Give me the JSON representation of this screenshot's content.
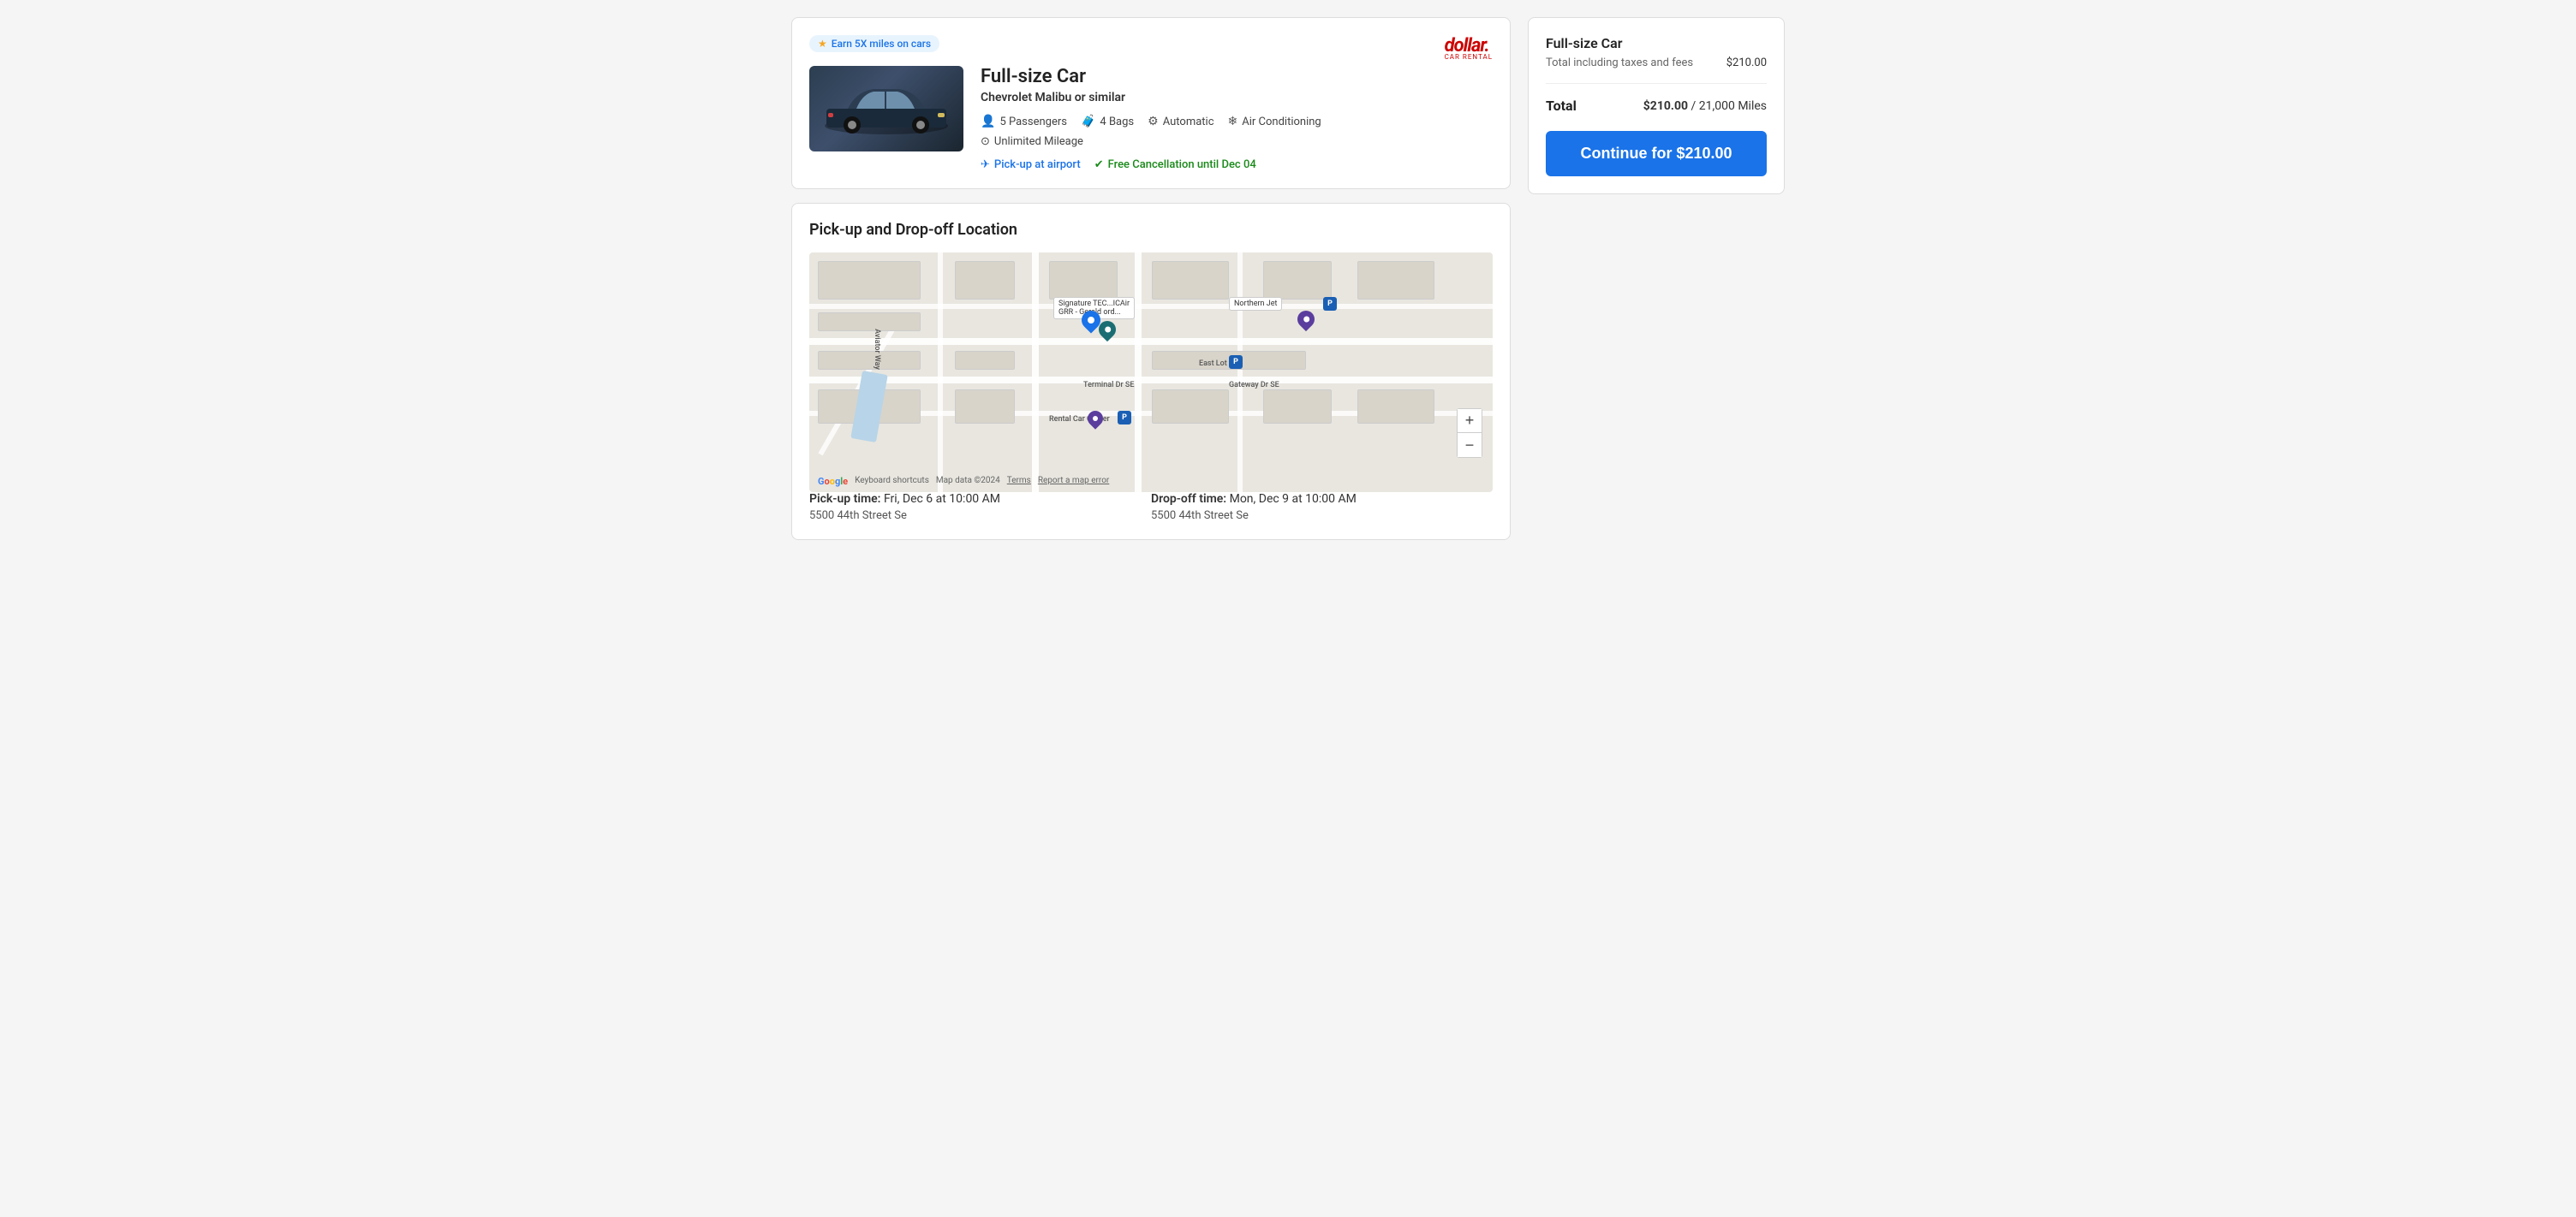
{
  "earn_badge": {
    "text": "Earn 5X miles on cars",
    "icon": "★"
  },
  "car": {
    "title": "Full-size Car",
    "subtitle": "Chevrolet Malibu or similar",
    "features": [
      {
        "icon": "👤",
        "label": "5 Passengers"
      },
      {
        "icon": "🧳",
        "label": "4 Bags"
      },
      {
        "icon": "⚙",
        "label": "Automatic"
      },
      {
        "icon": "❄",
        "label": "Air Conditioning"
      }
    ],
    "mileage": "Unlimited Mileage",
    "pickup_airport": "Pick-up at airport",
    "cancellation": "Free Cancellation until Dec 04",
    "brand_logo": "dollar.",
    "brand_sub": "CAR RENTAL"
  },
  "map_section": {
    "title": "Pick-up and Drop-off Location",
    "labels": [
      "Signature TEC...ICAir",
      "GRR - Gerald ord...",
      "Northern Jet",
      "East Lot",
      "Rental Car Center",
      "Terminal Dr SE",
      "Gateway Dr SE",
      "Aviator Way"
    ],
    "controls": {
      "zoom_in": "+",
      "zoom_out": "−"
    },
    "footer": {
      "keyboard_shortcuts": "Keyboard shortcuts",
      "map_data": "Map data ©2024",
      "terms": "Terms",
      "report": "Report a map error"
    }
  },
  "location": {
    "pickup_label": "Pick-up time:",
    "pickup_time": "Fri, Dec 6 at 10:00 AM",
    "pickup_address": "5500 44th Street Se",
    "dropoff_label": "Drop-off time:",
    "dropoff_time": "Mon, Dec 9 at 10:00 AM",
    "dropoff_address": "5500 44th Street Se"
  },
  "summary": {
    "title": "Full-size Car",
    "subtitle": "Total including taxes and fees",
    "price_detail": "$210.00",
    "total_label": "Total",
    "total_value": "$210.00",
    "miles": "21,000 Miles",
    "continue_btn": "Continue for $210.00"
  }
}
